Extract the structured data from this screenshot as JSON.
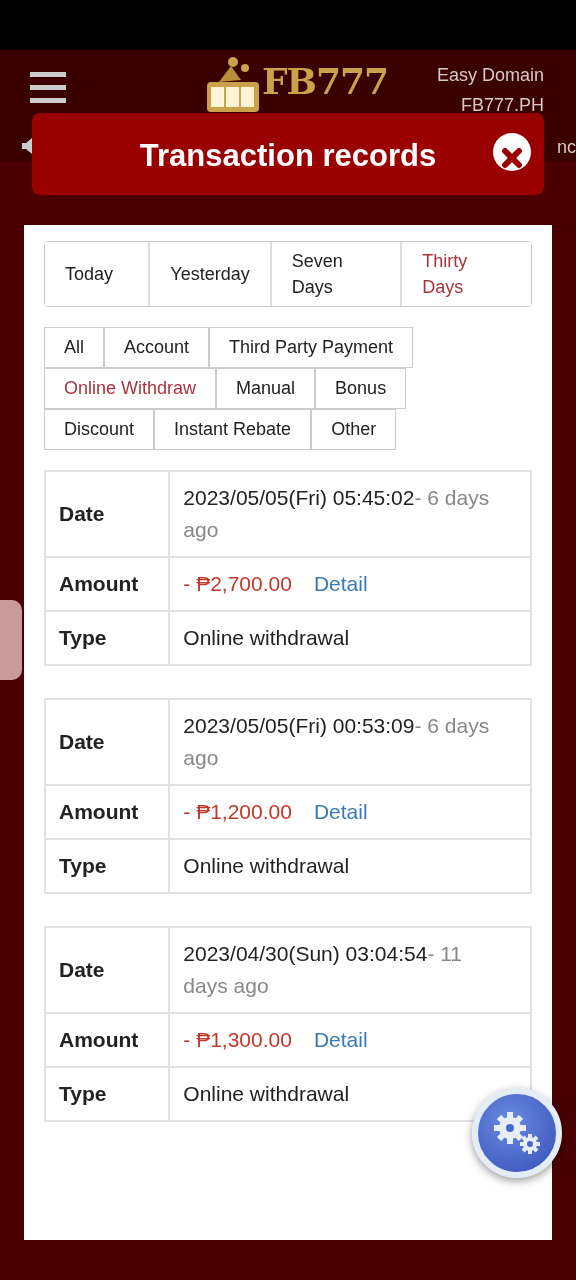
{
  "header": {
    "logo_text": "FB777",
    "domain_label": "Easy Domain",
    "domain": "FB777.PH",
    "marquee_text": "nc"
  },
  "modal": {
    "title": "Transaction records"
  },
  "period_tabs": [
    {
      "label": "Today",
      "selected": false
    },
    {
      "label": "Yesterday",
      "selected": false
    },
    {
      "label": "Seven Days",
      "selected": false
    },
    {
      "label": "Thirty Days",
      "selected": true
    }
  ],
  "type_filters": [
    {
      "label": "All",
      "selected": false
    },
    {
      "label": "Account",
      "selected": false
    },
    {
      "label": "Third Party Payment",
      "selected": false
    },
    {
      "label": "Online Withdraw",
      "selected": true
    },
    {
      "label": "Manual",
      "selected": false
    },
    {
      "label": "Bonus",
      "selected": false
    },
    {
      "label": "Discount",
      "selected": false
    },
    {
      "label": "Instant Rebate",
      "selected": false
    },
    {
      "label": "Other",
      "selected": false
    }
  ],
  "records": [
    {
      "date_label": "Date",
      "date": "2023/05/05(Fri) 05:45:02",
      "ago": "- 6 days ago",
      "amount_label": "Amount",
      "amount": "- ₱2,700.00",
      "detail": "Detail",
      "type_label": "Type",
      "type": "Online withdrawal"
    },
    {
      "date_label": "Date",
      "date": "2023/05/05(Fri) 00:53:09",
      "ago": "- 6 days ago",
      "amount_label": "Amount",
      "amount": "- ₱1,200.00",
      "detail": "Detail",
      "type_label": "Type",
      "type": "Online withdrawal"
    },
    {
      "date_label": "Date",
      "date": "2023/04/30(Sun) 03:04:54",
      "ago": "- 11 days ago",
      "amount_label": "Amount",
      "amount": "- ₱1,300.00",
      "detail": "Detail",
      "type_label": "Type",
      "type": "Online withdrawal"
    }
  ]
}
